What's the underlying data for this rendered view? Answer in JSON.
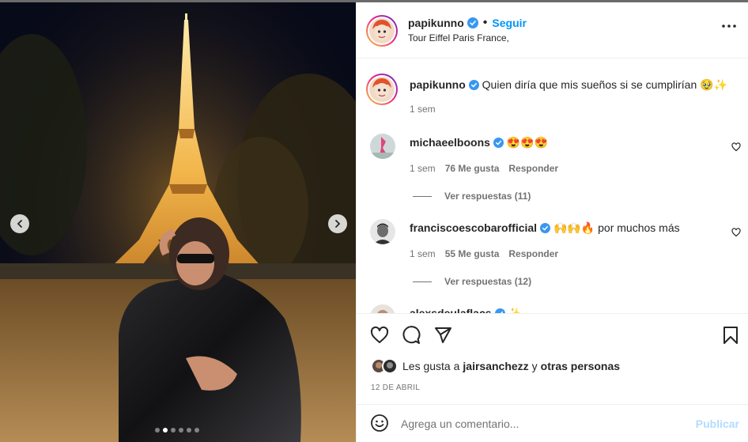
{
  "post": {
    "username": "papikunno",
    "follow_label": "Seguir",
    "location": "Tour Eiffel Paris France,",
    "more_icon": "more-horizontal-icon"
  },
  "photo": {
    "carousel_count": 6,
    "carousel_active": 2
  },
  "caption": {
    "username": "papikunno",
    "text": "Quien diría que mis sueños si se cumplirían 🥹✨",
    "time": "1 sem"
  },
  "comments": [
    {
      "username": "michaeelboons",
      "text": "😍😍😍",
      "time": "1 sem",
      "likes": "76 Me gusta",
      "reply_label": "Responder",
      "replies": "Ver respuestas (11)"
    },
    {
      "username": "franciscoescobarofficial",
      "text": "🙌🙌🔥 por muchos más",
      "time": "1 sem",
      "likes": "55 Me gusta",
      "reply_label": "Responder",
      "replies": "Ver respuestas (12)"
    },
    {
      "username": "alexsdeulaflacs",
      "text": "✨"
    }
  ],
  "likes_line": {
    "prefix": "Les gusta a",
    "user": "jairsanchezz",
    "connector": "y",
    "others": "otras personas"
  },
  "date": "12 DE ABRIL",
  "add_comment": {
    "placeholder": "Agrega un comentario...",
    "publish_label": "Publicar"
  },
  "colors": {
    "accent": "#0095f6",
    "verified": "#3897f0",
    "muted": "#737373"
  }
}
